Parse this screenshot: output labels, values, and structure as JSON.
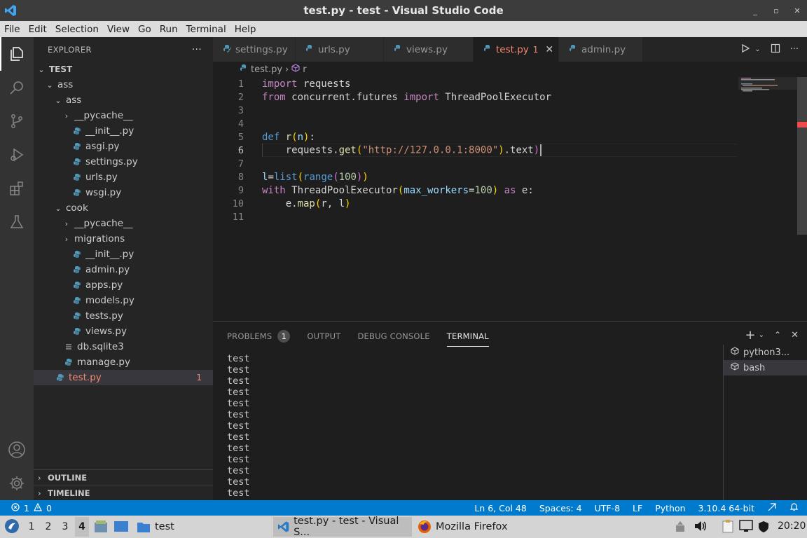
{
  "window": {
    "title": "test.py - test - Visual Studio Code",
    "controls": [
      "_",
      "▫",
      "✕"
    ]
  },
  "menu": [
    "File",
    "Edit",
    "Selection",
    "View",
    "Go",
    "Run",
    "Terminal",
    "Help"
  ],
  "sidebar": {
    "header": "EXPLORER",
    "more": "···",
    "tree": [
      {
        "label": "TEST",
        "depth": 0,
        "chev": "⌄",
        "kind": "root"
      },
      {
        "label": "ass",
        "depth": 1,
        "chev": "⌄",
        "kind": "folder"
      },
      {
        "label": "ass",
        "depth": 2,
        "chev": "⌄",
        "kind": "folder"
      },
      {
        "label": "__pycache__",
        "depth": 3,
        "chev": "›",
        "kind": "folder"
      },
      {
        "label": "__init__.py",
        "depth": 3,
        "kind": "py"
      },
      {
        "label": "asgi.py",
        "depth": 3,
        "kind": "py"
      },
      {
        "label": "settings.py",
        "depth": 3,
        "kind": "py"
      },
      {
        "label": "urls.py",
        "depth": 3,
        "kind": "py"
      },
      {
        "label": "wsgi.py",
        "depth": 3,
        "kind": "py"
      },
      {
        "label": "cook",
        "depth": 2,
        "chev": "⌄",
        "kind": "folder"
      },
      {
        "label": "__pycache__",
        "depth": 3,
        "chev": "›",
        "kind": "folder"
      },
      {
        "label": "migrations",
        "depth": 3,
        "chev": "›",
        "kind": "folder"
      },
      {
        "label": "__init__.py",
        "depth": 3,
        "kind": "py"
      },
      {
        "label": "admin.py",
        "depth": 3,
        "kind": "py"
      },
      {
        "label": "apps.py",
        "depth": 3,
        "kind": "py"
      },
      {
        "label": "models.py",
        "depth": 3,
        "kind": "py"
      },
      {
        "label": "tests.py",
        "depth": 3,
        "kind": "py"
      },
      {
        "label": "views.py",
        "depth": 3,
        "kind": "py"
      },
      {
        "label": "db.sqlite3",
        "depth": 2,
        "kind": "db"
      },
      {
        "label": "manage.py",
        "depth": 2,
        "kind": "py"
      },
      {
        "label": "test.py",
        "depth": 1,
        "kind": "py",
        "selected": true,
        "errors": "1"
      }
    ],
    "outline": "OUTLINE",
    "timeline": "TIMELINE"
  },
  "tabs": [
    {
      "label": "settings.py"
    },
    {
      "label": "urls.py"
    },
    {
      "label": "views.py"
    },
    {
      "label": "test.py",
      "active": true,
      "errors": "1",
      "close": "✕"
    },
    {
      "label": "admin.py"
    }
  ],
  "breadcrumb": {
    "file": "test.py",
    "sep": "›",
    "symbol": "r"
  },
  "editor": {
    "lines": [
      "1",
      "2",
      "3",
      "4",
      "5",
      "6",
      "7",
      "8",
      "9",
      "10",
      "11"
    ],
    "current_line": "6"
  },
  "panel": {
    "tabs": [
      {
        "label": "PROBLEMS",
        "badge": "1"
      },
      {
        "label": "OUTPUT"
      },
      {
        "label": "DEBUG CONSOLE"
      },
      {
        "label": "TERMINAL",
        "active": true
      }
    ],
    "output": [
      "test",
      "test",
      "test",
      "test",
      "test",
      "test",
      "test",
      "test",
      "test",
      "test",
      "test",
      "test",
      "test"
    ],
    "terminals": [
      {
        "label": "python3..."
      },
      {
        "label": "bash",
        "selected": true
      }
    ]
  },
  "status": {
    "errors": "1",
    "warnings": "0",
    "position": "Ln 6, Col 48",
    "spaces": "Spaces: 4",
    "encoding": "UTF-8",
    "eol": "LF",
    "language": "Python",
    "interpreter": "3.10.4 64-bit"
  },
  "taskbar": {
    "workspaces": [
      "1",
      "2",
      "3",
      "4"
    ],
    "active_workspace": "4",
    "folder": "test",
    "apps": [
      {
        "label": "test.py - test - Visual S...",
        "active": true
      },
      {
        "label": "Mozilla Firefox"
      }
    ],
    "clock": "20:20"
  },
  "colors": {
    "accent": "#007acc",
    "error": "#f48771",
    "keyword": "#c586c0",
    "string": "#ce9178"
  }
}
